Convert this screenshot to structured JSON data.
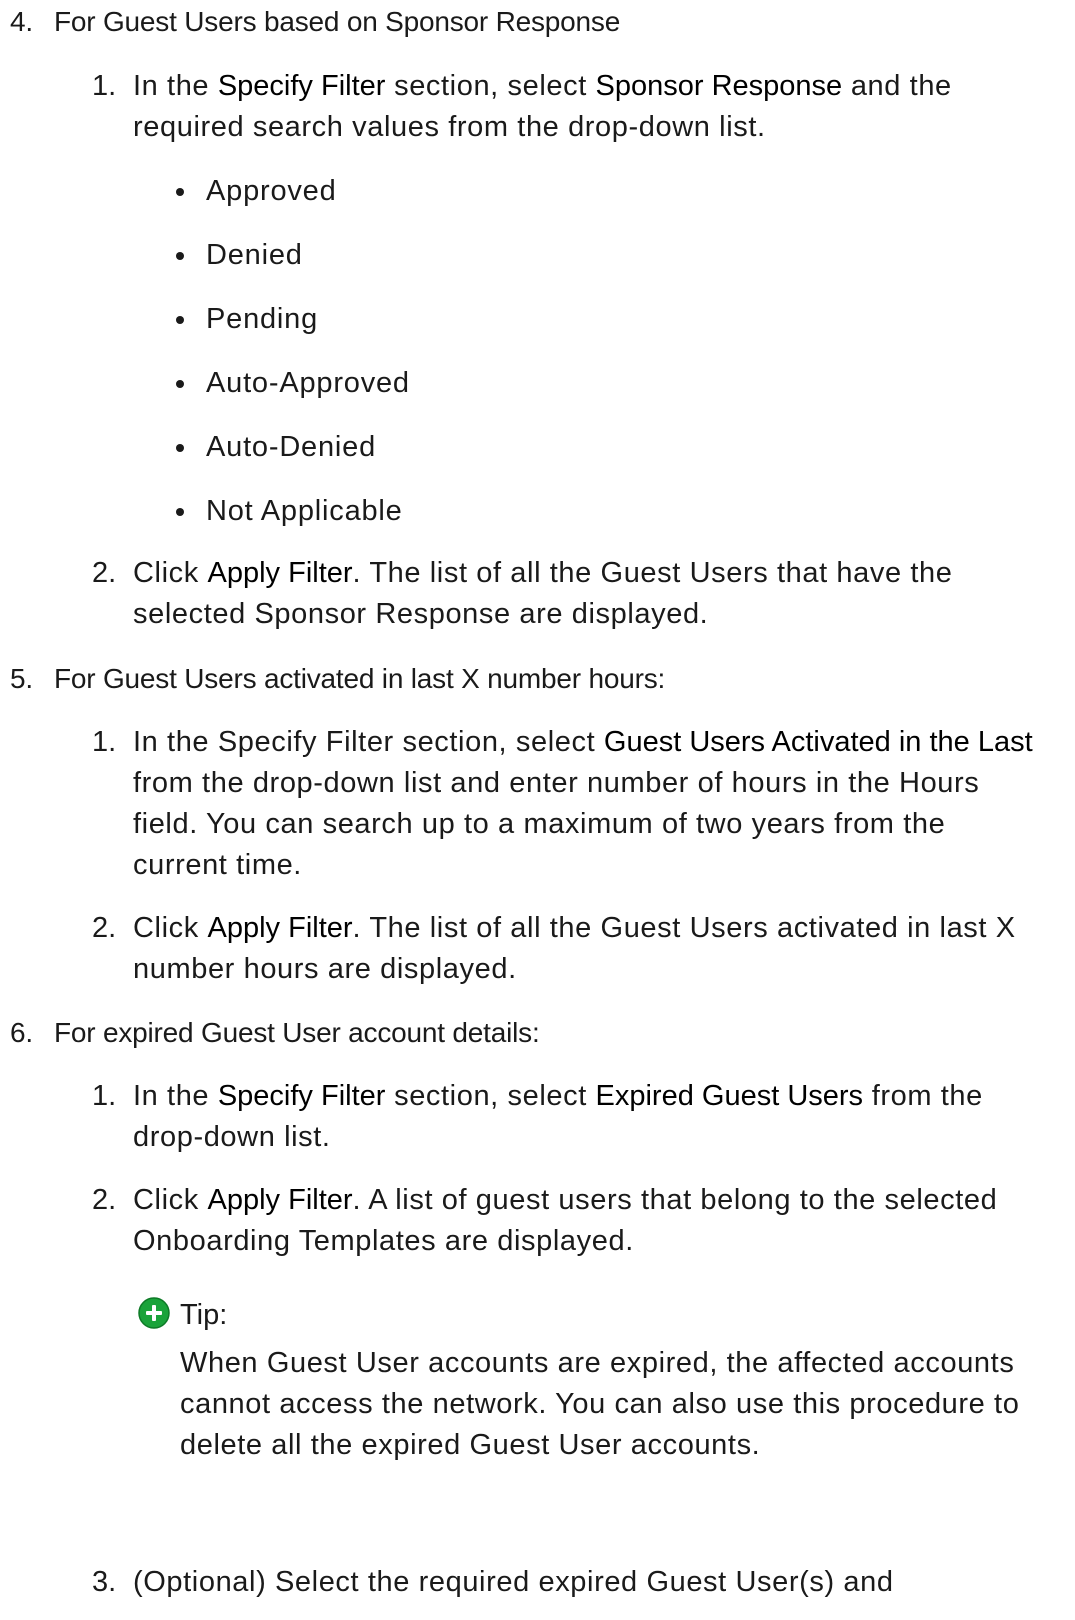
{
  "steps": [
    {
      "number": "4.",
      "heading": "For Guest Users based on Sponsor Response",
      "substeps": [
        {
          "number": "1.",
          "parts": [
            "In the ",
            "Specify Filter",
            " section, select ",
            "Sponsor Response",
            " and the required search values from the drop-down list."
          ],
          "bullets": [
            "Approved",
            "Denied",
            "Pending",
            "Auto-Approved",
            "Auto-Denied",
            "Not Applicable"
          ]
        },
        {
          "number": "2.",
          "parts": [
            "Click ",
            "Apply Filter",
            ". The list of all the Guest Users that have the selected Sponsor Response are displayed."
          ]
        }
      ]
    },
    {
      "number": "5.",
      "heading": "For Guest Users activated in last X number hours:",
      "substeps": [
        {
          "number": "1.",
          "parts": [
            "In the Specify Filter section, select ",
            "Guest Users Activated in the Last",
            " from the drop-down list and enter number of hours in the Hours field. You can search up to a maximum of two years from the current time."
          ]
        },
        {
          "number": "2.",
          "parts": [
            "Click ",
            "Apply Filter",
            ". The list of all the Guest Users activated in last X number hours are displayed."
          ]
        }
      ]
    },
    {
      "number": "6.",
      "heading": "For expired Guest User account details:",
      "substeps": [
        {
          "number": "1.",
          "parts": [
            "In the ",
            "Specify Filter",
            " section, select ",
            "Expired Guest Users",
            " from the drop-down list."
          ]
        },
        {
          "number": "2.",
          "parts": [
            "Click ",
            "Apply Filter",
            ". A list of guest users that belong to the selected Onboarding Templates are displayed."
          ],
          "tip": {
            "icon": "plus-circle-icon",
            "label": "Tip:",
            "text": "When Guest User accounts are expired, the affected accounts cannot access the network. You can also use this procedure to delete all the expired Guest User accounts."
          }
        },
        {
          "number": "3.",
          "parts": [
            "(Optional) Select the required expired Guest User(s) and"
          ]
        }
      ]
    }
  ],
  "colors": {
    "text": "#1a1a1a",
    "tip_icon": "#1aa33a"
  }
}
